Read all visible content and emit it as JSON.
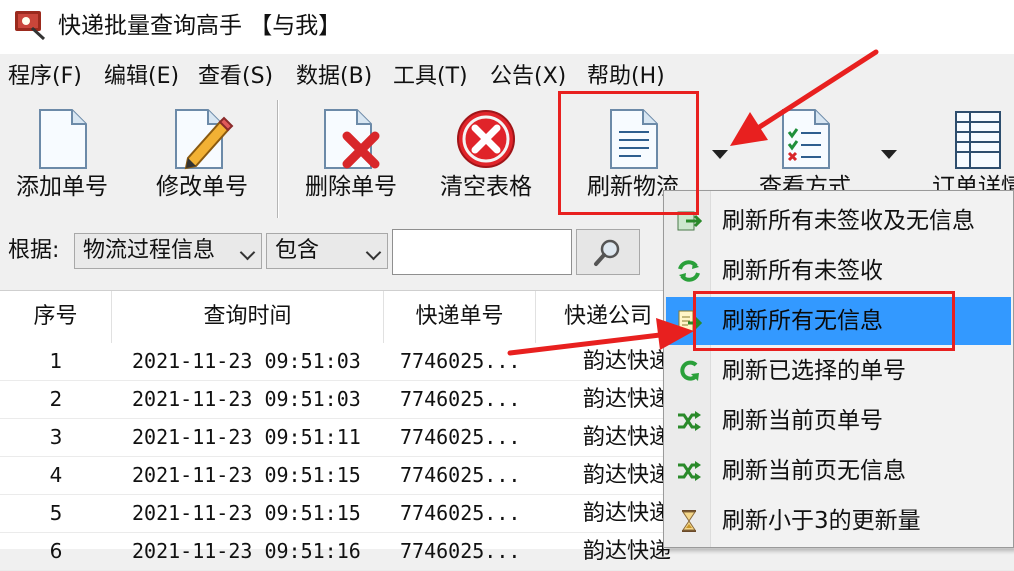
{
  "window": {
    "title": "快递批量查询高手 【与我】"
  },
  "menu": [
    "程序(F)",
    "编辑(E)",
    "查看(S)",
    "数据(B)",
    "工具(T)",
    "公告(X)",
    "帮助(H)"
  ],
  "toolbar": {
    "add": "添加单号",
    "edit": "修改单号",
    "delete": "删除单号",
    "clear": "清空表格",
    "refresh": "刷新物流",
    "view": "查看方式",
    "order": "订单详情"
  },
  "filter": {
    "label": "根据:",
    "field": "物流过程信息",
    "condition": "包含",
    "query": ""
  },
  "table": {
    "headers": [
      "序号",
      "查询时间",
      "快递单号",
      "快递公司"
    ],
    "rows": [
      [
        "1",
        "2021-11-23 09:51:03",
        "7746025...",
        "韵达快递"
      ],
      [
        "2",
        "2021-11-23 09:51:03",
        "7746025...",
        "韵达快递"
      ],
      [
        "3",
        "2021-11-23 09:51:11",
        "7746025...",
        "韵达快递"
      ],
      [
        "4",
        "2021-11-23 09:51:15",
        "7746025...",
        "韵达快递"
      ],
      [
        "5",
        "2021-11-23 09:51:15",
        "7746025...",
        "韵达快递"
      ],
      [
        "6",
        "2021-11-23 09:51:16",
        "7746025...",
        "韵达快递"
      ]
    ]
  },
  "refresh_menu": {
    "items": [
      {
        "label": "刷新所有未签收及无信息",
        "icon": "refresh-green-icon"
      },
      {
        "label": "刷新所有未签收",
        "icon": "refresh-cycle-icon"
      },
      {
        "label": "刷新所有无信息",
        "icon": "refresh-yellow-icon",
        "selected": true
      },
      {
        "label": "刷新已选择的单号",
        "icon": "refresh-arrow-icon"
      },
      {
        "label": "刷新当前页单号",
        "icon": "shuffle-icon"
      },
      {
        "label": "刷新当前页无信息",
        "icon": "shuffle-icon"
      },
      {
        "label": "刷新小于3的更新量",
        "icon": "hourglass-icon"
      }
    ]
  },
  "colors": {
    "accent": "#3399ff",
    "annotation": "#e8201f"
  }
}
